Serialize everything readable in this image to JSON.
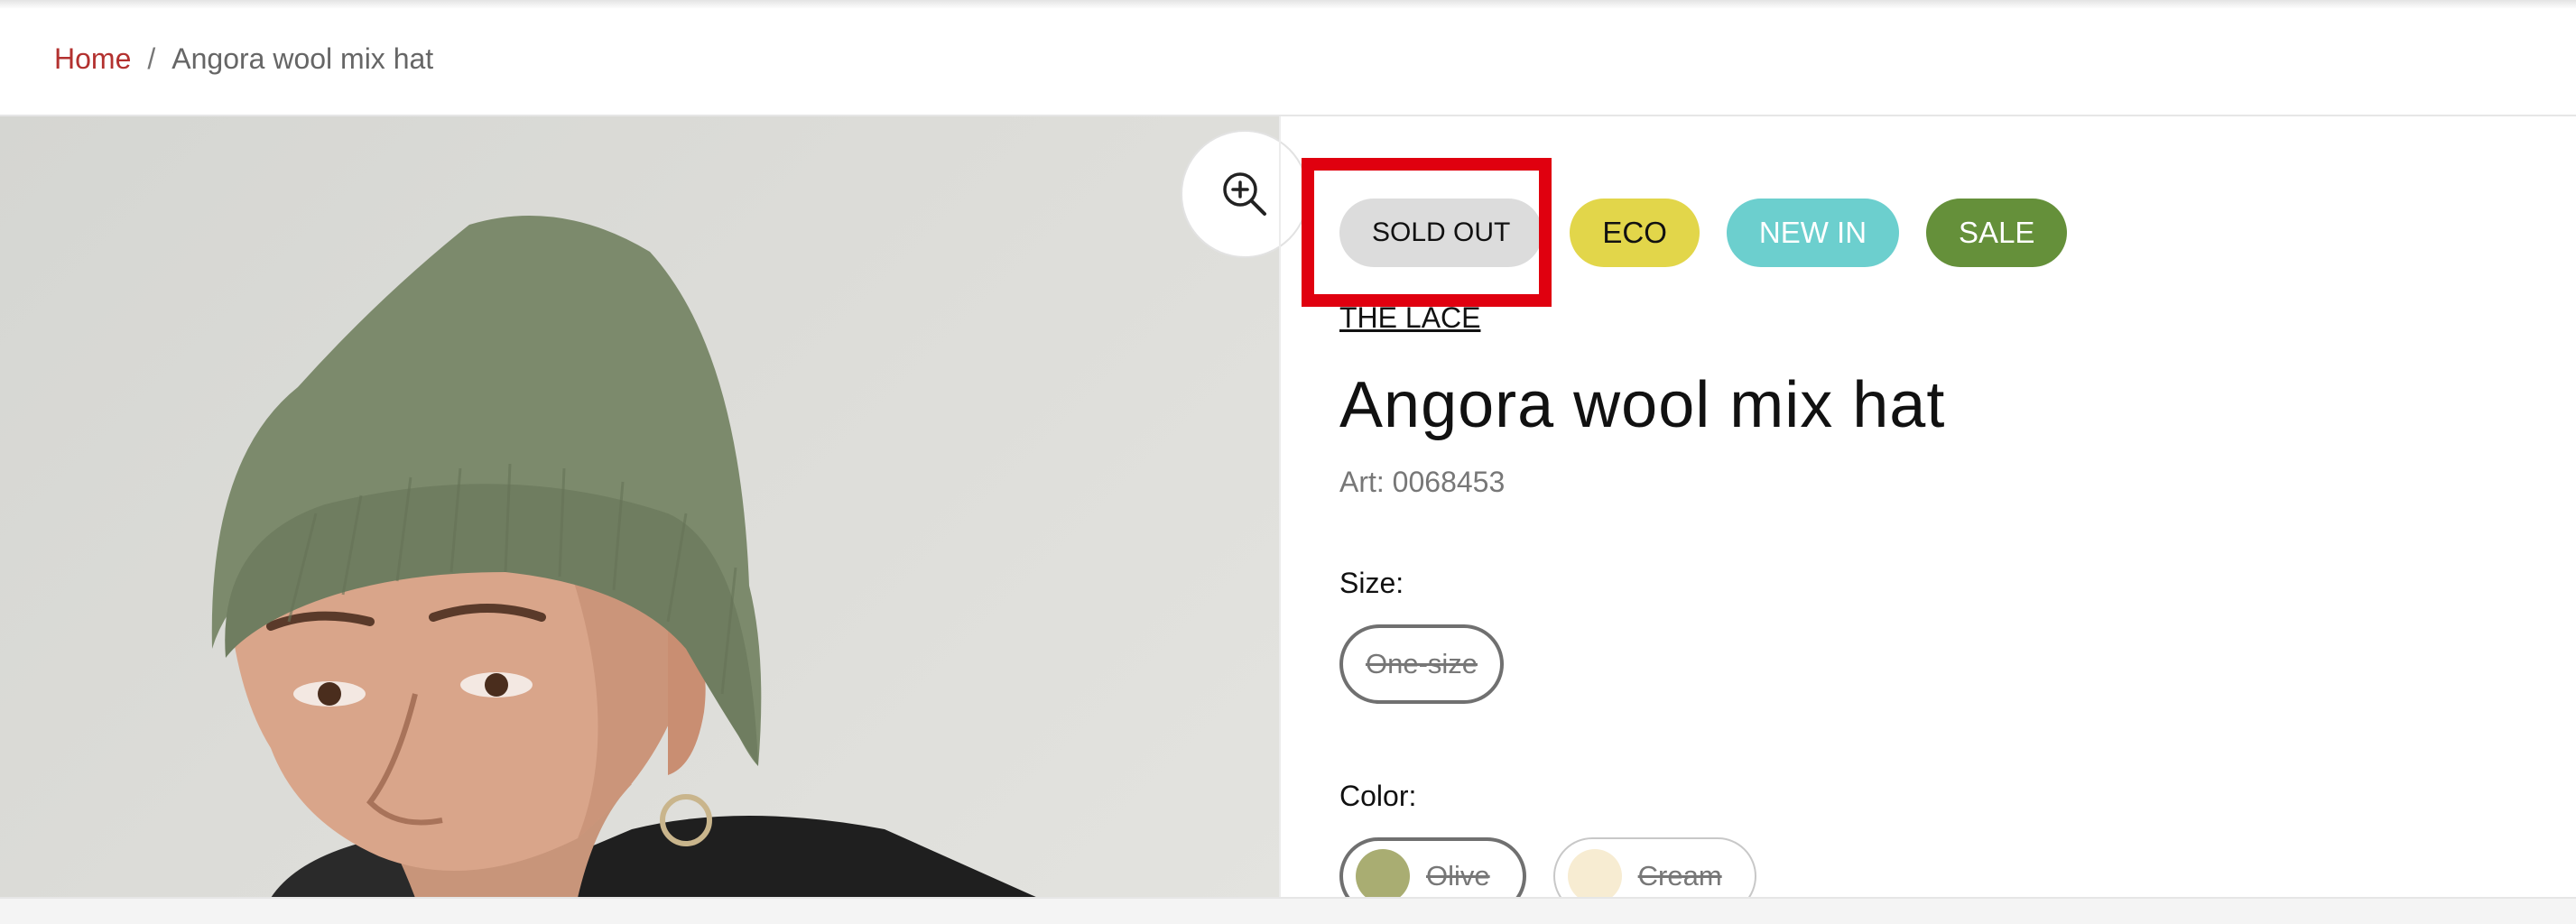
{
  "breadcrumb": {
    "home": "Home",
    "separator": "/",
    "current": "Angora wool mix hat"
  },
  "badges": {
    "sold_out": "SOLD OUT",
    "eco": "ECO",
    "new_in": "NEW IN",
    "sale": "SALE"
  },
  "product": {
    "brand": "THE LACE",
    "title": "Angora wool mix hat",
    "art": "Art: 0068453"
  },
  "size": {
    "label": "Size:",
    "options": [
      "One-size"
    ]
  },
  "color": {
    "label": "Color:",
    "options": [
      {
        "name": "Olive",
        "swatch": "#a9ad72"
      },
      {
        "name": "Cream",
        "swatch": "#f7ecd2"
      }
    ]
  },
  "colors": {
    "accent_link": "#b3312f",
    "highlight": "#e0000f",
    "badge_soldout": "#dcdcdc",
    "badge_eco": "#e2d64a",
    "badge_newin": "#6ccfce",
    "badge_sale": "#65903a"
  },
  "icons": {
    "zoom": "zoom-in-icon"
  }
}
